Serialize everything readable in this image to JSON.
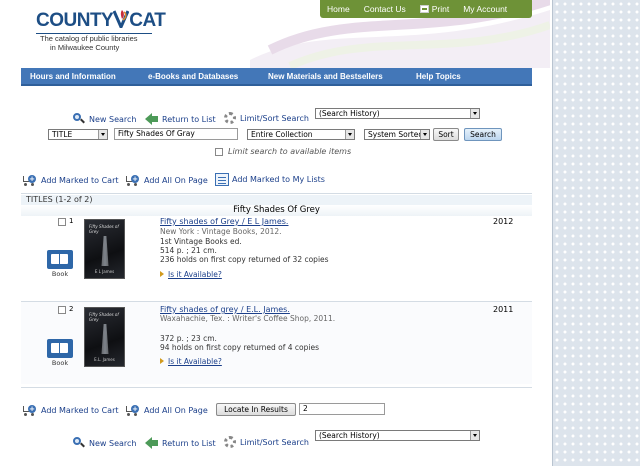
{
  "header": {
    "logo_county": "COUNTY",
    "logo_cat": "CAT",
    "logo_tagline_1": "The catalog of public libraries",
    "logo_tagline_2": "in Milwaukee County",
    "topnav": [
      "Home",
      "Contact Us",
      "Print",
      "My Account"
    ]
  },
  "mainnav": [
    "Hours and Information",
    "e-Books and Databases",
    "New Materials and Bestsellers",
    "Help Topics"
  ],
  "search": {
    "new_search": "New Search",
    "return_to_list": "Return to List",
    "limit_sort": "Limit/Sort Search",
    "history_select": "(Search History)",
    "field_select": "TITLE",
    "query": "Fifty Shades Of Gray",
    "collection_select": "Entire Collection",
    "sort_select": "System Sorted",
    "sort_button": "Sort",
    "search_button": "Search",
    "limit_available": "Limit search to available items"
  },
  "actions": {
    "add_marked_cart": "Add Marked to Cart",
    "add_all_page": "Add All On Page",
    "add_marked_lists": "Add Marked to My Lists"
  },
  "results": {
    "titles_count": "TITLES (1-2 of 2)",
    "subheading": "Fifty Shades Of Grey",
    "items": [
      {
        "num": "1",
        "title": "Fifty shades of Grey / E L James.",
        "pub": "New York : Vintage Books, 2012.",
        "edition": "1st Vintage Books ed.",
        "extent": "514 p. ; 21 cm.",
        "holds": "236 holds on first copy returned of 32 copies",
        "availability": "Is it Available?",
        "format": "Book",
        "year": "2012",
        "cover_title": "Fifty Shades of Grey",
        "cover_author": "E L James"
      },
      {
        "num": "2",
        "title": "Fifty shades of grey / E.L. James.",
        "pub": "Waxahachie, Tex. : Writer's Coffee Shop, 2011.",
        "edition": "",
        "extent": "372 p. ; 23 cm.",
        "holds": "94 holds on first copy returned of 4 copies",
        "availability": "Is it Available?",
        "format": "Book",
        "year": "2011",
        "cover_title": "Fifty Shades of Grey",
        "cover_author": "E.L. James"
      }
    ]
  },
  "bottom": {
    "add_marked_cart": "Add Marked to Cart",
    "add_all_page": "Add All On Page",
    "locate_button": "Locate In Results",
    "locate_value": "2",
    "new_search": "New Search",
    "return_to_list": "Return to List",
    "limit_sort": "Limit/Sort Search",
    "history_select": "(Search History)"
  },
  "colors": {
    "topnav_green": "#6e9237",
    "mainnav_blue": "#4377b8",
    "link_blue": "#1b3f8a"
  }
}
